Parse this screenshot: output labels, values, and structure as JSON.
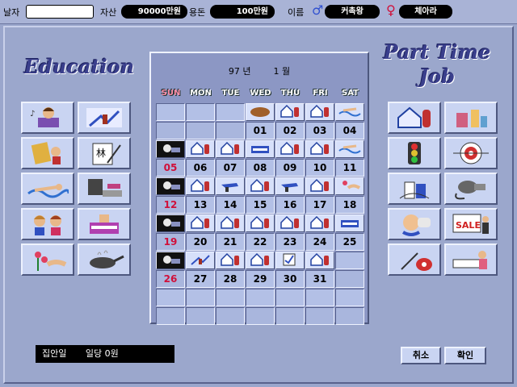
{
  "topbar": {
    "date_label": "날자",
    "date_value": "",
    "assets_label": "자산",
    "assets_value": "90000만원",
    "allowance_label": "용돈",
    "allowance_value": "100만원",
    "name_label": "이름",
    "male_symbol": "♂",
    "father_name": "커촉왕",
    "female_symbol": "♀",
    "daughter_name": "체아라"
  },
  "education": {
    "title": "Education",
    "buttons": [
      {
        "icon": "study-icon"
      },
      {
        "icon": "art-icon"
      },
      {
        "icon": "painting-icon"
      },
      {
        "icon": "writing-icon"
      },
      {
        "icon": "swimming-icon"
      },
      {
        "icon": "computer-icon"
      },
      {
        "icon": "friends-icon"
      },
      {
        "icon": "piano-icon"
      },
      {
        "icon": "flower-icon"
      },
      {
        "icon": "cooking-icon"
      }
    ]
  },
  "job": {
    "title_line1": "Part Time",
    "title_line2": "Job",
    "buttons": [
      {
        "icon": "house-cleaning-icon"
      },
      {
        "icon": "cosmetics-icon"
      },
      {
        "icon": "traffic-light-icon"
      },
      {
        "icon": "darts-icon"
      },
      {
        "icon": "milk-delivery-icon"
      },
      {
        "icon": "hair-dryer-icon"
      },
      {
        "icon": "baby-care-icon"
      },
      {
        "icon": "sale-sign-icon"
      },
      {
        "icon": "vacuum-icon"
      },
      {
        "icon": "nursing-icon"
      }
    ]
  },
  "calendar": {
    "year": "97 년",
    "month": "1 월",
    "day_names": [
      "SUN",
      "MON",
      "TUE",
      "WED",
      "THU",
      "FRI",
      "SAT"
    ],
    "weeks": [
      [
        {
          "n": "",
          "i": ""
        },
        {
          "n": "",
          "i": ""
        },
        {
          "n": "",
          "i": ""
        },
        {
          "n": "01",
          "i": "food"
        },
        {
          "n": "02",
          "i": "house"
        },
        {
          "n": "03",
          "i": "house"
        },
        {
          "n": "04",
          "i": "swim"
        }
      ],
      [
        {
          "n": "05",
          "i": "rest"
        },
        {
          "n": "06",
          "i": "house"
        },
        {
          "n": "07",
          "i": "house"
        },
        {
          "n": "08",
          "i": "piano"
        },
        {
          "n": "09",
          "i": "house"
        },
        {
          "n": "10",
          "i": "house"
        },
        {
          "n": "11",
          "i": "swim"
        }
      ],
      [
        {
          "n": "12",
          "i": "rest"
        },
        {
          "n": "13",
          "i": "house"
        },
        {
          "n": "14",
          "i": "gun"
        },
        {
          "n": "15",
          "i": "house"
        },
        {
          "n": "16",
          "i": "gun"
        },
        {
          "n": "17",
          "i": "house"
        },
        {
          "n": "18",
          "i": "flower"
        }
      ],
      [
        {
          "n": "19",
          "i": "rest"
        },
        {
          "n": "20",
          "i": "house"
        },
        {
          "n": "21",
          "i": "house"
        },
        {
          "n": "22",
          "i": "house"
        },
        {
          "n": "23",
          "i": "house"
        },
        {
          "n": "24",
          "i": "house"
        },
        {
          "n": "25",
          "i": "piano"
        }
      ],
      [
        {
          "n": "26",
          "i": "rest"
        },
        {
          "n": "27",
          "i": "art"
        },
        {
          "n": "28",
          "i": "house"
        },
        {
          "n": "29",
          "i": "house"
        },
        {
          "n": "30",
          "i": "write"
        },
        {
          "n": "31",
          "i": "house"
        },
        {
          "n": "",
          "i": ""
        }
      ],
      [
        {
          "n": "",
          "i": ""
        },
        {
          "n": "",
          "i": ""
        },
        {
          "n": "",
          "i": ""
        },
        {
          "n": "",
          "i": ""
        },
        {
          "n": "",
          "i": ""
        },
        {
          "n": "",
          "i": ""
        },
        {
          "n": "",
          "i": ""
        }
      ]
    ]
  },
  "status": {
    "activity": "집안일",
    "pay": "일당 0원"
  },
  "buttons": {
    "cancel": "취소",
    "confirm": "확인"
  },
  "colors": {
    "background": "#9aa6cc",
    "sunday": "#d0103a",
    "title": "#3a3f8c"
  }
}
